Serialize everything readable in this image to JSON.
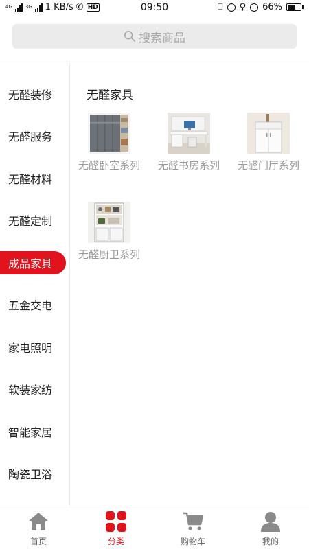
{
  "status_bar": {
    "network_tags": [
      "4G",
      "3G"
    ],
    "speed": "1 KB/s",
    "hd": "HD",
    "time": "09:50",
    "battery": "66%",
    "battery_level": 0.66
  },
  "search": {
    "placeholder": "搜索商品"
  },
  "sidebar": {
    "items": [
      {
        "label": "无醛装修"
      },
      {
        "label": "无醛服务"
      },
      {
        "label": "无醛材料"
      },
      {
        "label": "无醛定制"
      },
      {
        "label": "成品家具",
        "active": true
      },
      {
        "label": "五金交电"
      },
      {
        "label": "家电照明"
      },
      {
        "label": "软装家纺"
      },
      {
        "label": "智能家居"
      },
      {
        "label": "陶瓷卫浴"
      }
    ]
  },
  "main": {
    "section_title": "无醛家具",
    "products": [
      {
        "name": "无醛卧室系列",
        "thumb": "wardrobe"
      },
      {
        "name": "无醛书房系列",
        "thumb": "desk"
      },
      {
        "name": "无醛门厅系列",
        "thumb": "cabinet"
      },
      {
        "name": "无醛厨卫系列",
        "thumb": "kitchen-shelf"
      }
    ]
  },
  "tabbar": {
    "tabs": [
      {
        "label": "首页",
        "icon": "home-icon"
      },
      {
        "label": "分类",
        "icon": "category-icon",
        "active": true
      },
      {
        "label": "购物车",
        "icon": "cart-icon"
      },
      {
        "label": "我的",
        "icon": "user-icon"
      }
    ]
  },
  "colors": {
    "accent": "#e1141d",
    "icon_gray": "#8a8a8a",
    "muted_text": "#9a9a9a"
  }
}
